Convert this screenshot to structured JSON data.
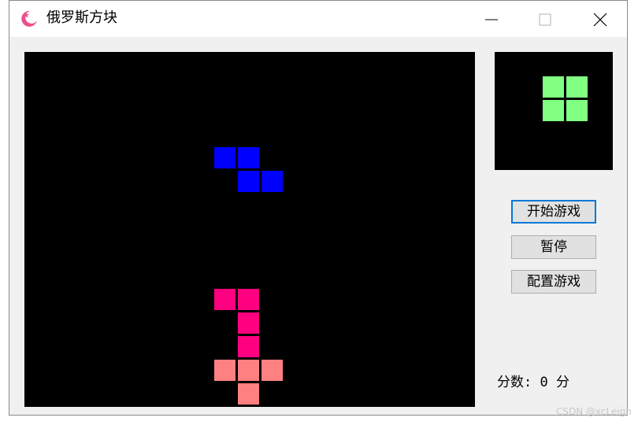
{
  "window": {
    "title": "俄罗斯方块",
    "icon": "moon-star-icon",
    "controls": [
      "minimize-icon",
      "maximize-icon",
      "close-icon"
    ]
  },
  "board": {
    "cols": 19,
    "rows": 15,
    "background": "#000000",
    "falling_piece": {
      "shape": "Z",
      "color": "#0000ff",
      "cells": [
        [
          8,
          4
        ],
        [
          9,
          4
        ],
        [
          9,
          5
        ],
        [
          10,
          5
        ]
      ]
    },
    "locked_blocks": [
      {
        "col": 8,
        "row": 10,
        "color": "#ff0080"
      },
      {
        "col": 9,
        "row": 10,
        "color": "#ff0080"
      },
      {
        "col": 9,
        "row": 11,
        "color": "#ff0080"
      },
      {
        "col": 9,
        "row": 12,
        "color": "#ff0080"
      },
      {
        "col": 8,
        "row": 13,
        "color": "#ff8080"
      },
      {
        "col": 9,
        "row": 13,
        "color": "#ff8080"
      },
      {
        "col": 10,
        "row": 13,
        "color": "#ff8080"
      },
      {
        "col": 9,
        "row": 14,
        "color": "#ff8080"
      }
    ]
  },
  "next_piece": {
    "shape": "O",
    "color": "#80ff80",
    "cells": [
      [
        2,
        1
      ],
      [
        3,
        1
      ],
      [
        2,
        2
      ],
      [
        3,
        2
      ]
    ]
  },
  "buttons": {
    "start": "开始游戏",
    "pause": "暂停",
    "config": "配置游戏"
  },
  "score": {
    "label": "分数:",
    "value": "0",
    "unit": "分"
  },
  "watermark": "CSDN @xcLeigh"
}
